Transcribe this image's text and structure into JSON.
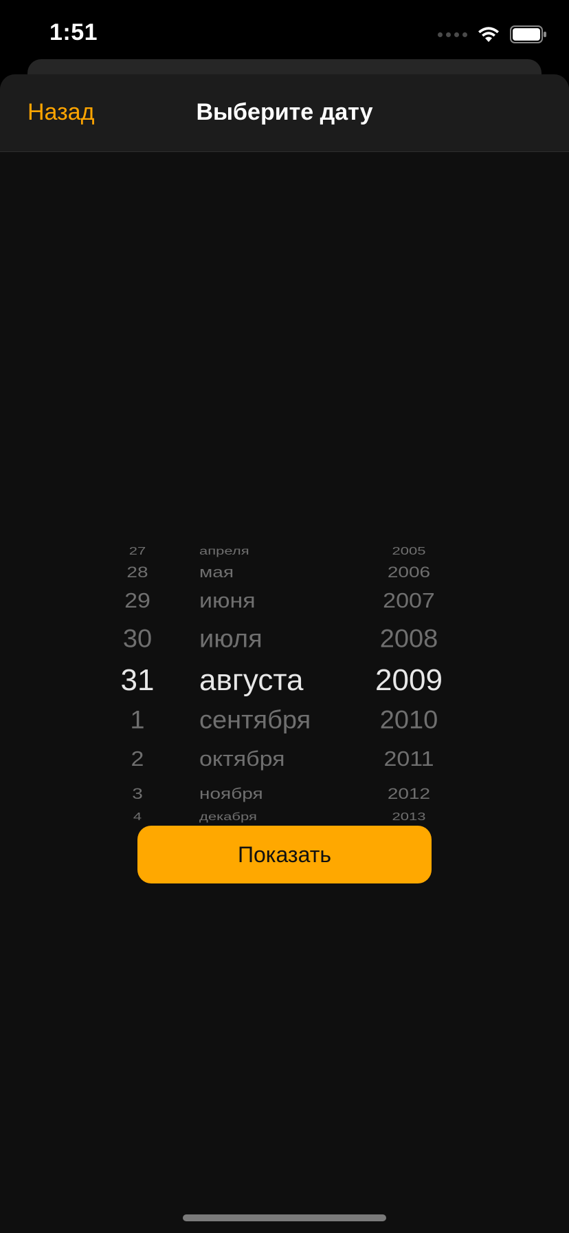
{
  "status_bar": {
    "time": "1:51",
    "icons": [
      "signal-dots-icon",
      "wifi-icon",
      "battery-icon"
    ]
  },
  "nav": {
    "back_label": "Назад",
    "title": "Выберите дату"
  },
  "picker": {
    "selected": {
      "day": "31",
      "month": "августа",
      "year": "2009"
    },
    "day_items": [
      "27",
      "28",
      "29",
      "30",
      "31",
      "1",
      "2",
      "3",
      "4"
    ],
    "month_items": [
      "апреля",
      "мая",
      "июня",
      "июля",
      "августа",
      "сентября",
      "октября",
      "ноября",
      "декабря"
    ],
    "year_items": [
      "2005",
      "2006",
      "2007",
      "2008",
      "2009",
      "2010",
      "2011",
      "2012",
      "2013"
    ]
  },
  "button": {
    "show_label": "Показать"
  },
  "colors": {
    "accent": "#ffa500",
    "button_bg": "#ffa800",
    "sheet_bg": "#0f0f0f",
    "nav_bg": "#1c1c1c"
  }
}
